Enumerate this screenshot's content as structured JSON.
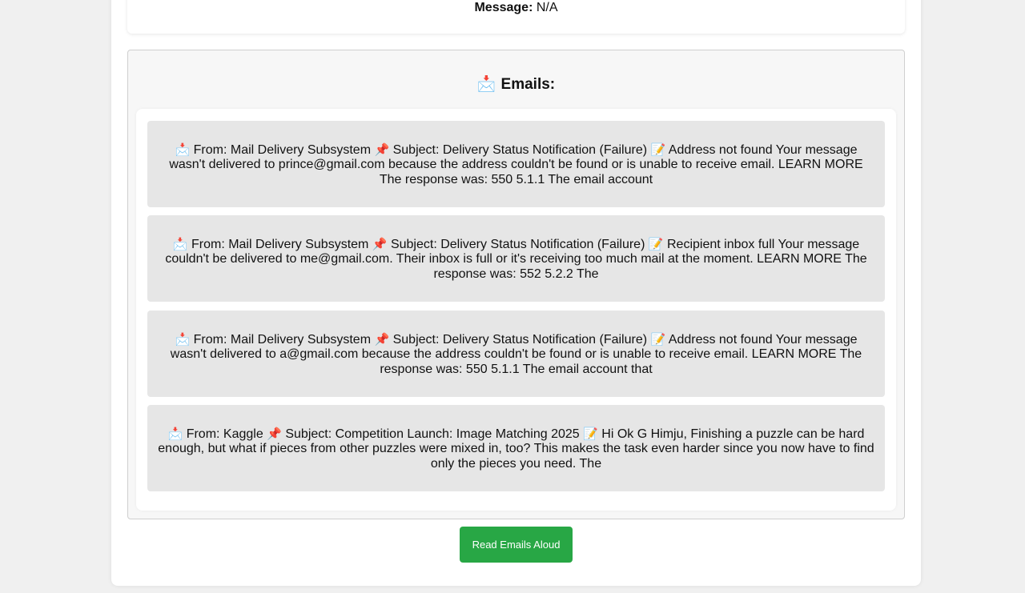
{
  "message": {
    "label": "Message:",
    "value": "N/A"
  },
  "emails_section": {
    "icon": "📩",
    "title": "Emails:",
    "items": [
      {
        "from_icon": "📩",
        "from": "From: Mail Delivery Subsystem",
        "subject_icon": "📌",
        "subject": "Subject: Delivery Status Notification (Failure)",
        "body_icon": "📝",
        "body": "Address not found Your message wasn't delivered to prince@gmail.com because the address couldn't be found or is unable to receive email. LEARN MORE The response was: 550 5.1.1 The email account"
      },
      {
        "from_icon": "📩",
        "from": "From: Mail Delivery Subsystem",
        "subject_icon": "📌",
        "subject": "Subject: Delivery Status Notification (Failure)",
        "body_icon": "📝",
        "body": "Recipient inbox full Your message couldn't be delivered to me@gmail.com. Their inbox is full or it's receiving too much mail at the moment. LEARN MORE The response was: 552 5.2.2 The"
      },
      {
        "from_icon": "📩",
        "from": "From: Mail Delivery Subsystem",
        "subject_icon": "📌",
        "subject": "Subject: Delivery Status Notification (Failure)",
        "body_icon": "📝",
        "body": "Address not found Your message wasn't delivered to a@gmail.com because the address couldn't be found or is unable to receive email. LEARN MORE The response was: 550 5.1.1 The email account that"
      },
      {
        "from_icon": "📩",
        "from": "From: Kaggle",
        "subject_icon": "📌",
        "subject": "Subject: Competition Launch: Image Matching 2025",
        "body_icon": "📝",
        "body": "Hi Ok G Himju, Finishing a puzzle can be hard enough, but what if pieces from other puzzles were mixed in, too? This makes the task even harder since you now have to find only the pieces you need. The"
      }
    ]
  },
  "read_button": {
    "label": "Read Emails Aloud",
    "color": "#28a745"
  },
  "icons": {
    "mail": "envelope-arrow-icon",
    "pin": "pushpin-icon",
    "memo": "memo-icon"
  }
}
